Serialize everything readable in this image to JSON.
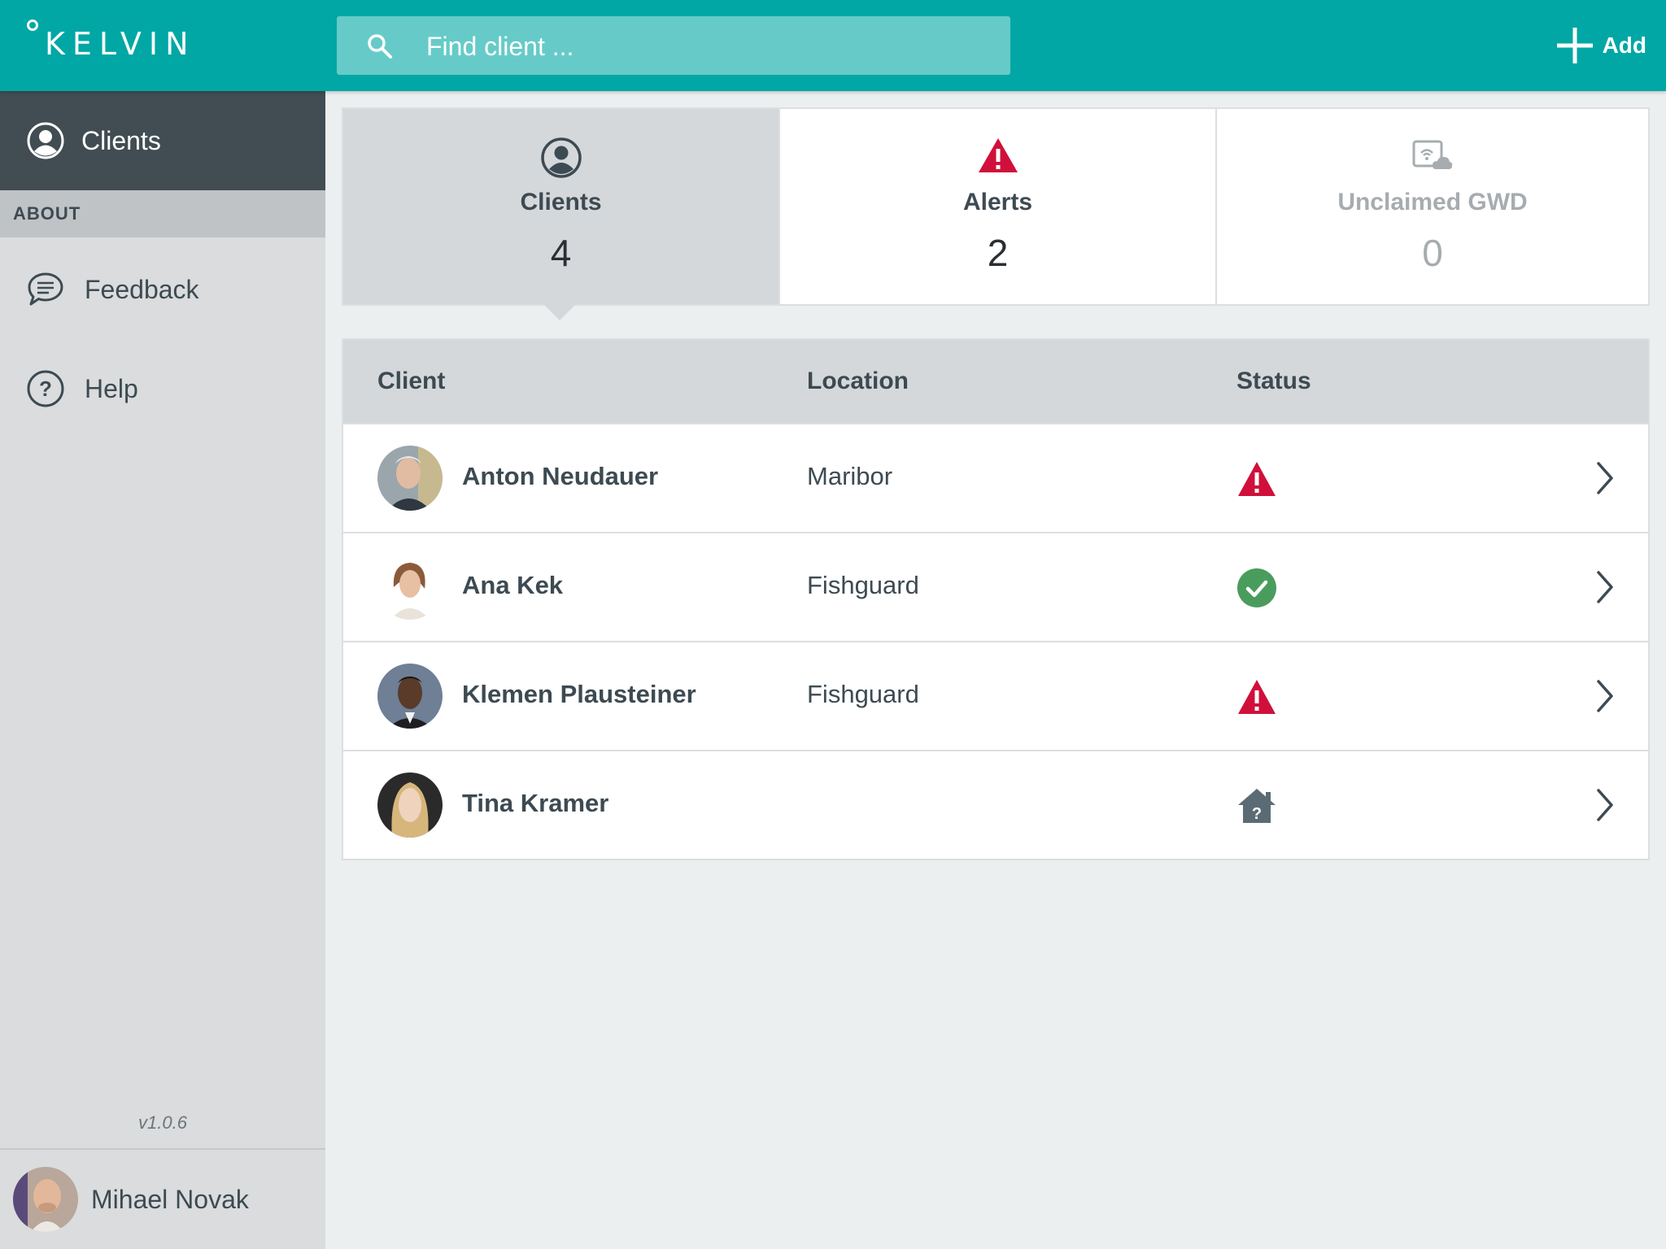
{
  "app": {
    "logo_text": "KELVIN"
  },
  "search": {
    "placeholder": "Find client ..."
  },
  "toolbar": {
    "add_label": "Add"
  },
  "sidebar": {
    "active_item": "Clients",
    "section_header": "ABOUT",
    "items": [
      {
        "label": "Feedback",
        "icon": "chat-bubble-icon"
      },
      {
        "label": "Help",
        "icon": "question-circle-icon"
      }
    ],
    "version": "v1.0.6",
    "user_name": "Mihael Novak"
  },
  "stats": [
    {
      "title": "Clients",
      "count": "4",
      "icon": "user-circle-icon",
      "active": true
    },
    {
      "title": "Alerts",
      "count": "2",
      "icon": "warning-triangle-icon",
      "active": false
    },
    {
      "title": "Unclaimed GWD",
      "count": "0",
      "icon": "device-cloud-icon",
      "active": false
    }
  ],
  "table": {
    "columns": [
      "Client",
      "Location",
      "Status"
    ],
    "rows": [
      {
        "name": "Anton Neudauer",
        "location": "Maribor",
        "status": "alert"
      },
      {
        "name": "Ana Kek",
        "location": "Fishguard",
        "status": "ok"
      },
      {
        "name": "Klemen Plausteiner",
        "location": "Fishguard",
        "status": "alert"
      },
      {
        "name": "Tina Kramer",
        "location": "",
        "status": "unknown-home"
      }
    ]
  },
  "colors": {
    "topbar": "#00a7a4",
    "sidebar_active": "#414d53",
    "alert": "#d0103a",
    "ok": "#4a9c5d",
    "home_unknown": "#5b6b75"
  }
}
